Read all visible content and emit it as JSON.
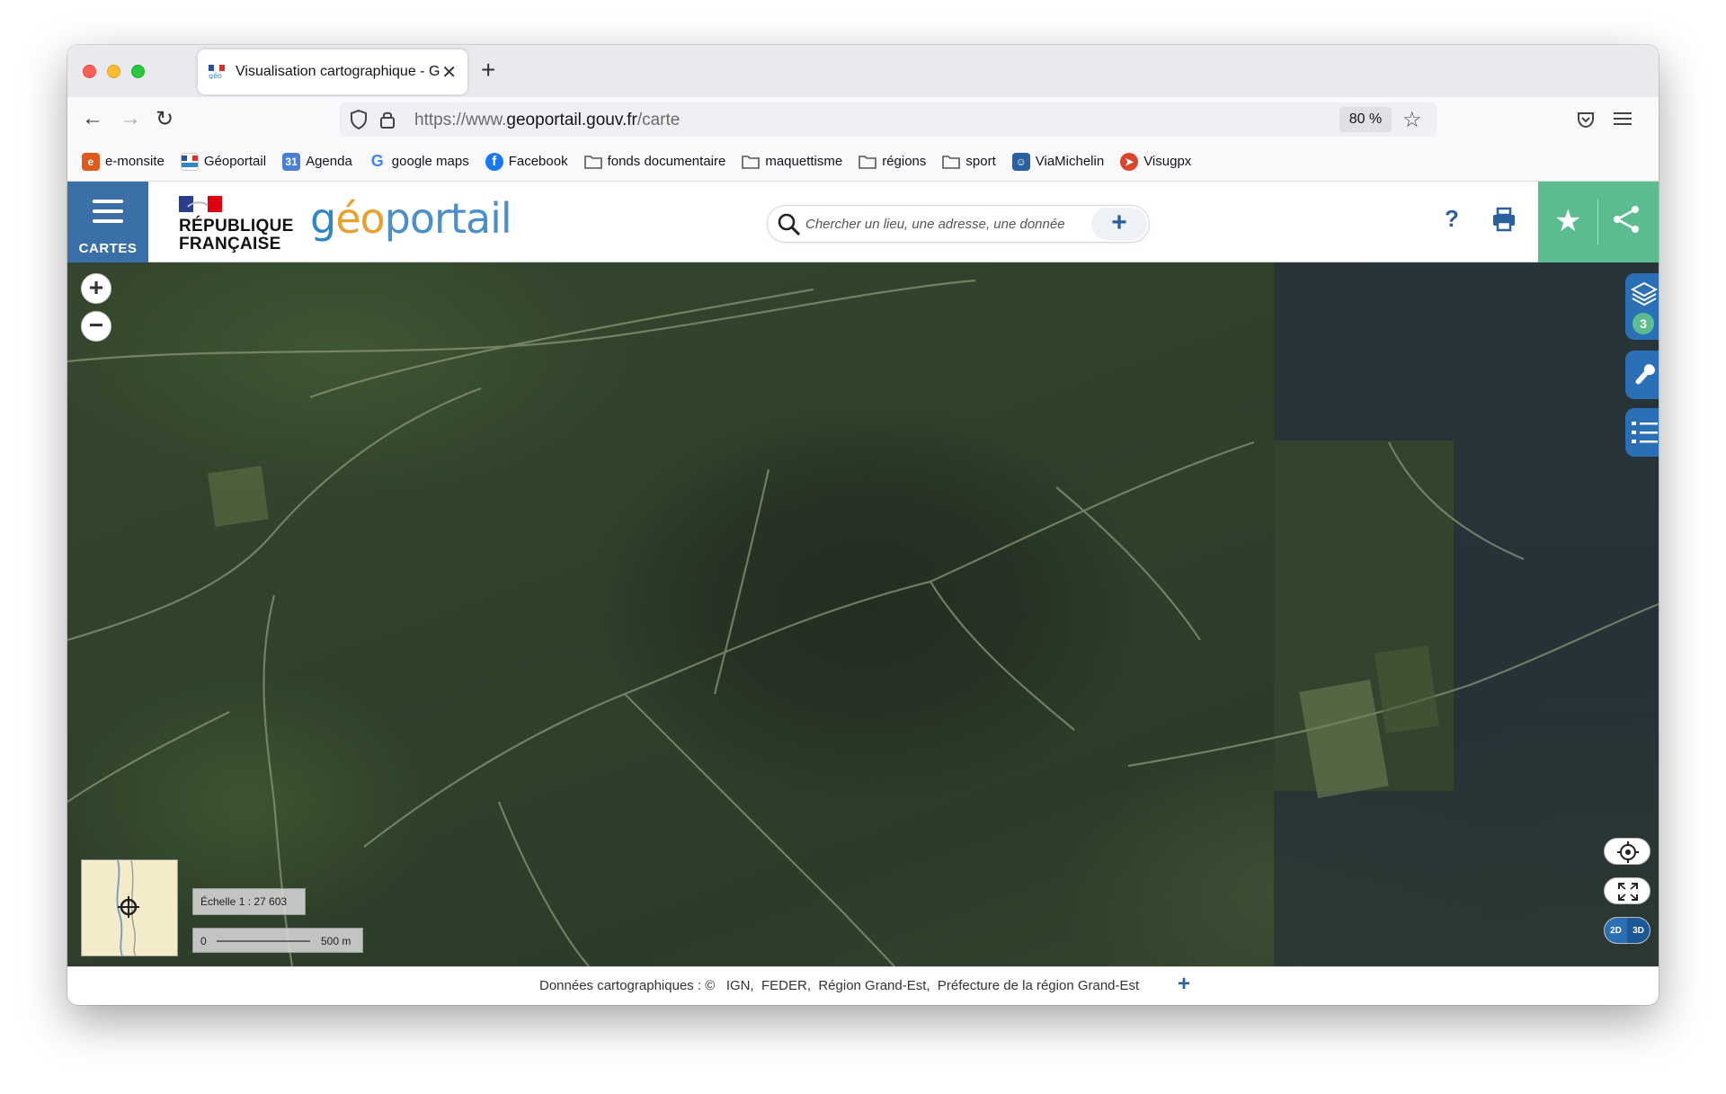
{
  "browser": {
    "tab_title": "Visualisation cartographique - G",
    "url_prefix": "https://www.",
    "url_domain": "geoportail.gouv.fr",
    "url_path": "/carte",
    "zoom_level": "80 %"
  },
  "bookmarks": [
    {
      "label": "e-monsite",
      "icon": "e-monsite-icon",
      "color": "#e05a1b"
    },
    {
      "label": "Géoportail",
      "icon": "geoportail-icon",
      "color": "#2f87c8"
    },
    {
      "label": "Agenda",
      "icon": "calendar-icon",
      "color": "#4a7fd4"
    },
    {
      "label": "google maps",
      "icon": "google-icon",
      "color": "#4285f4"
    },
    {
      "label": "Facebook",
      "icon": "facebook-icon",
      "color": "#1877f2"
    },
    {
      "label": "fonds documentaire",
      "icon": "folder-icon",
      "color": "#555555"
    },
    {
      "label": "maquettisme",
      "icon": "folder-icon",
      "color": "#555555"
    },
    {
      "label": "régions",
      "icon": "folder-icon",
      "color": "#555555"
    },
    {
      "label": "sport",
      "icon": "folder-icon",
      "color": "#555555"
    },
    {
      "label": "ViaMichelin",
      "icon": "viamichelin-icon",
      "color": "#2a5fa0"
    },
    {
      "label": "Visugpx",
      "icon": "visugpx-icon",
      "color": "#d9442a"
    }
  ],
  "header": {
    "cartes_label": "CARTES",
    "rf_line1": "RÉPUBLIQUE",
    "rf_line2": "FRANÇAISE",
    "logo_part1": "g",
    "logo_part2": "éo",
    "logo_part3": "portail",
    "search_placeholder": "Chercher un lieu, une adresse, une donnée",
    "help_label": "?"
  },
  "map": {
    "layer_count": "3",
    "scale_text": "Échelle 1 : 27 603",
    "scalebar_start": "0",
    "scalebar_end": "500 m",
    "mode_2d": "2D",
    "mode_3d": "3D"
  },
  "footer": {
    "attribution": "Données cartographiques : ©   IGN,  FEDER,  Région Grand-Est,  Préfecture de la région Grand-Est"
  },
  "colors": {
    "brand_blue": "#3a6fa8",
    "brand_green": "#5bbd8f",
    "tool_blue": "#2b6fb4"
  }
}
